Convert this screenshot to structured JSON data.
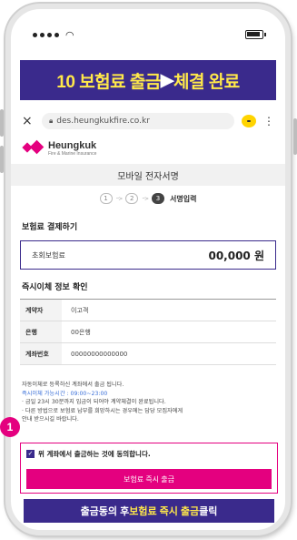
{
  "banner": {
    "part1": "10 보험료 출금 ",
    "arrow": "▶",
    "part2": " 체결 완료"
  },
  "browser": {
    "url": "des.heungkukfire.co.kr",
    "close": "×",
    "more": "⋮"
  },
  "brand": {
    "name": "Heungkuk",
    "sub": "Fire & Marine Insurance"
  },
  "page": {
    "title": "모바일 전자서명"
  },
  "steps": {
    "s1": "1",
    "s2": "2",
    "s3": "3",
    "arrow": "···>",
    "label": "서명입력"
  },
  "payment": {
    "section_title": "보험료 결제하기",
    "label": "초회보험료",
    "amount": "00,000 원"
  },
  "account": {
    "section_title": "즉시이체 정보 확인",
    "rows": [
      {
        "key": "계약자",
        "value": "이고객"
      },
      {
        "key": "은행",
        "value": "00은행"
      },
      {
        "key": "계좌번호",
        "value": "00000000000000"
      }
    ]
  },
  "notes": {
    "line1": "자동이체로 등록하신 계좌에서 출금 됩니다.",
    "line2": "즉시이체 가능시간 : 09:00~23:00",
    "line3": "· 금일 23시 30분까지 입금이 되어야 계약체결이 완료됩니다.",
    "line4": "· 다른 방법으로 보험료 납부를 희망하시는 경우에는 담당 모집자에게",
    "line5": "안내 받으시길 바랍니다."
  },
  "agree": {
    "checkbox_mark": "✓",
    "text": "위 계좌에서 출금하는 것에 동의합니다."
  },
  "pay_button": {
    "label": "보험료 즉시 출금"
  },
  "badge": {
    "number": "1"
  },
  "bottom_banner": {
    "part1": "출금동의 후 ",
    "part2": "보험료 즉시 출금",
    "part3": " 클릭"
  },
  "colors": {
    "accent": "#e4007f",
    "navy": "#3a2a8c",
    "yellow": "#ffe84a"
  }
}
